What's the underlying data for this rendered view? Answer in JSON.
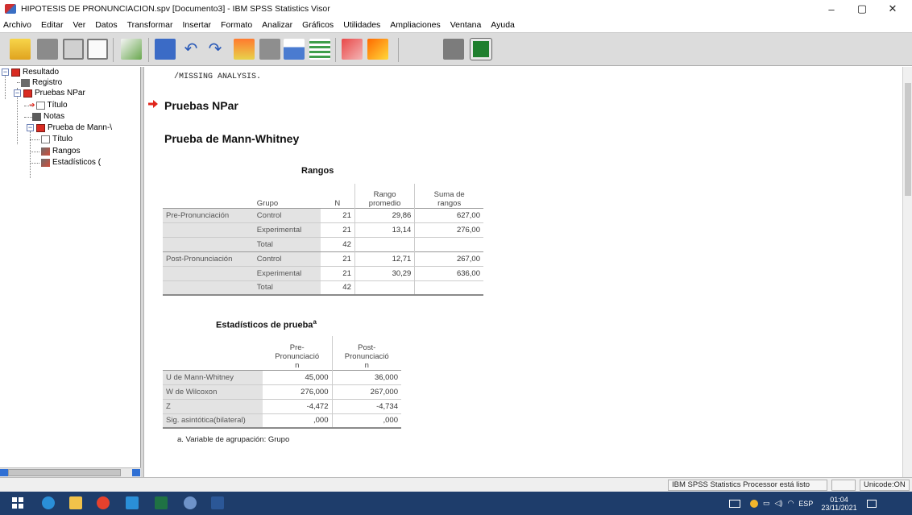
{
  "window": {
    "title": "HIPOTESIS DE PRONUNCIACION.spv [Documento3] - IBM SPSS Statistics Visor",
    "minimize": "–",
    "maximize": "▢",
    "close": "✕"
  },
  "menu": [
    "Archivo",
    "Editar",
    "Ver",
    "Datos",
    "Transformar",
    "Insertar",
    "Formato",
    "Analizar",
    "Gráficos",
    "Utilidades",
    "Ampliaciones",
    "Ventana",
    "Ayuda"
  ],
  "toolbar_icons": [
    "open-folder-icon",
    "save-icon",
    "print-icon",
    "print-preview-icon",
    "export-icon",
    "recall-dialog-icon",
    "undo-icon",
    "redo-icon",
    "goto-data-icon",
    "goto-case-icon",
    "goto-variable-icon",
    "variables-icon",
    "output-icon",
    "designated-window-icon",
    "show-all-icon",
    "insert-output-icon"
  ],
  "tree": {
    "root": "Resultado",
    "registro": "Registro",
    "npar": "Pruebas NPar",
    "titulo1": "Título",
    "notas": "Notas",
    "mann": "Prueba de Mann-\\",
    "titulo2": "Título",
    "rangos": "Rangos",
    "estadisticos": "Estadísticos ("
  },
  "output": {
    "syntax": "/MISSING ANALYSIS.",
    "heading1": "Pruebas NPar",
    "heading2": "Prueba de Mann-Whitney",
    "rangos": {
      "caption": "Rangos",
      "headers": {
        "grupo": "Grupo",
        "n": "N",
        "rango_a": "Rango",
        "rango_b": "promedio",
        "suma_a": "Suma de",
        "suma_b": "rangos"
      },
      "rows": [
        {
          "var": "Pre-Pronunciación",
          "grupo": "Control",
          "n": "21",
          "rango": "29,86",
          "suma": "627,00"
        },
        {
          "var": "",
          "grupo": "Experimental",
          "n": "21",
          "rango": "13,14",
          "suma": "276,00"
        },
        {
          "var": "",
          "grupo": "Total",
          "n": "42",
          "rango": "",
          "suma": ""
        },
        {
          "var": "Post-Pronunciación",
          "grupo": "Control",
          "n": "21",
          "rango": "12,71",
          "suma": "267,00"
        },
        {
          "var": "",
          "grupo": "Experimental",
          "n": "21",
          "rango": "30,29",
          "suma": "636,00"
        },
        {
          "var": "",
          "grupo": "Total",
          "n": "42",
          "rango": "",
          "suma": ""
        }
      ]
    },
    "estadisticos": {
      "caption": "Estadísticos de prueba",
      "caption_sup": "a",
      "headers": {
        "pre_a": "Pre-",
        "pre_b": "Pronunciació",
        "pre_c": "n",
        "post_a": "Post-",
        "post_b": "Pronunciació",
        "post_c": "n"
      },
      "rows": [
        {
          "label": "U de Mann-Whitney",
          "pre": "45,000",
          "post": "36,000"
        },
        {
          "label": "W de Wilcoxon",
          "pre": "276,000",
          "post": "267,000"
        },
        {
          "label": "Z",
          "pre": "-4,472",
          "post": "-4,734"
        },
        {
          "label": "Sig. asintótica(bilateral)",
          "pre": ",000",
          "post": ",000"
        }
      ],
      "footnote": "a. Variable de agrupación: Grupo"
    }
  },
  "status": {
    "processor": "IBM SPSS Statistics Processor está listo",
    "unicode": "Unicode:ON"
  },
  "taskbar": {
    "lang": "ESP",
    "time": "01:04",
    "date": "23/11/2021"
  },
  "colors": {
    "accent_red": "#e0251b",
    "taskbar": "#1e3d6b",
    "toolbar": "#dcdcdc",
    "row_header": "#e3e3e3"
  }
}
